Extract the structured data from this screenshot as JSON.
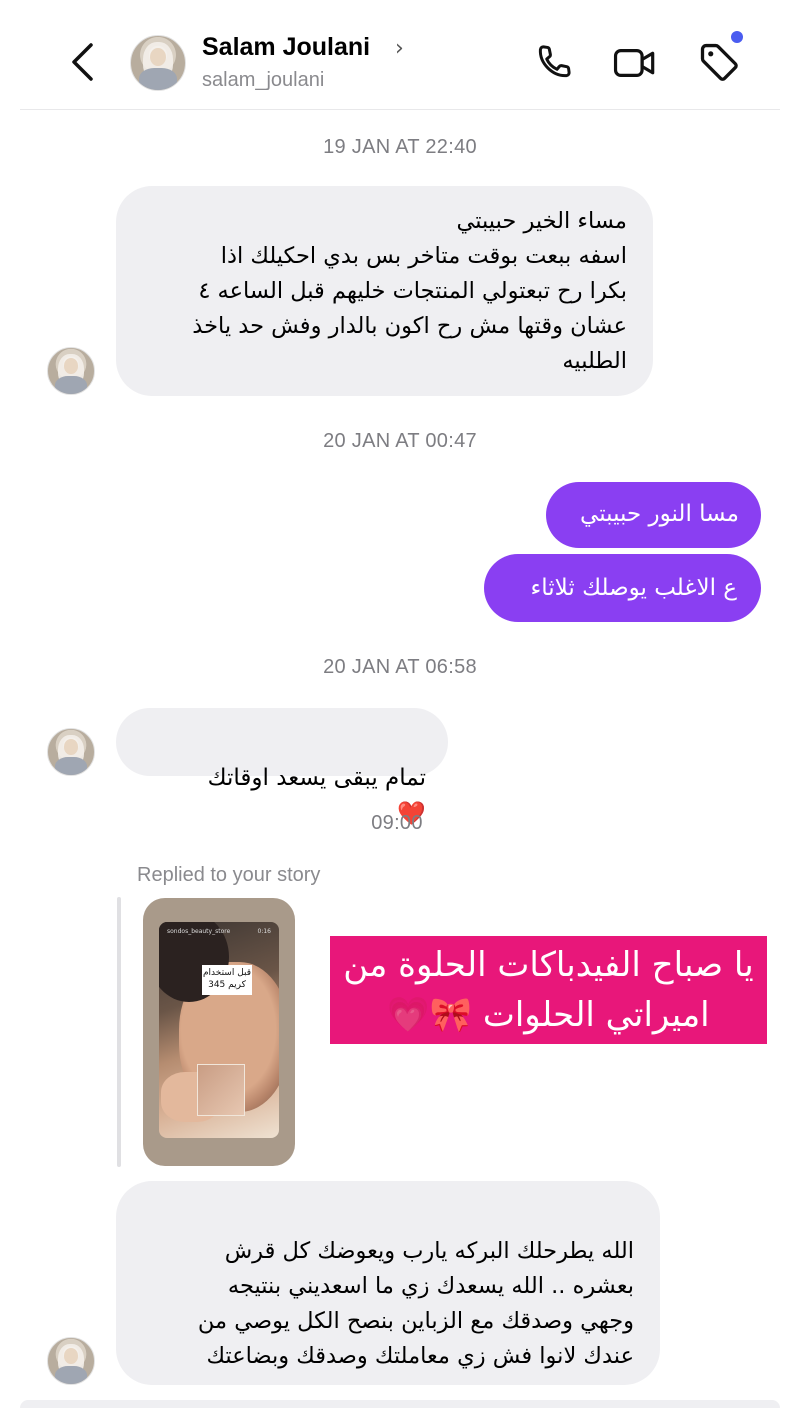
{
  "header": {
    "back_icon": "chevron-left-icon",
    "name": "Salam Joulani",
    "name_chevron": "›",
    "username": "salam_joulani",
    "icons": [
      "phone-icon",
      "video-camera-icon",
      "tag-icon"
    ],
    "notification_dot_color": "#4a5cf0"
  },
  "timestamps": {
    "t1": "19 JAN AT 22:40",
    "t2": "20 JAN AT 00:47",
    "t3": "20 JAN AT 06:58",
    "t4": "09:00"
  },
  "messages": {
    "m1": "مساء الخير حبيبتي\nاسفه ببعت بوقت متاخر بس بدي احكيلك اذا\nبكرا رح تبعتولي المنتجات خليهم قبل الساعه ٤\nعشان وقتها مش رح اكون بالدار وفش حد ياخذ\nالطلبيه",
    "m2": "مسا النور حبيبتي",
    "m3": "ع الاغلب يوصلك ثلاثاء",
    "m4": "تمام يبقى يسعد اوقاتك",
    "m5_text": "الله يطرحلك البركه يارب ويعوضك كل قرش\nبعشره .. الله يسعدك زي ما اسعديني بنتيجه\nوجهي وصدقك مع الزباين بنصح الكل يوصي من\nعندك لانوا فش زي معاملتك وصدقك وبضاعتك",
    "m5_emojis": "😍 ❤️"
  },
  "story": {
    "label": "Replied to your story",
    "account": "sondos_beauty_store",
    "time": "0:16",
    "sticker": "قبل استخدام\nكريم 345",
    "banner_text": "يا صباح الفيدباكات الحلوة من\nاميراتي الحلوات 🎀💗"
  },
  "colors": {
    "outgoing_bubble": "#8a3ff2",
    "incoming_bubble": "#efeff2",
    "banner": "#e8177a",
    "heart": "#e8232a"
  }
}
